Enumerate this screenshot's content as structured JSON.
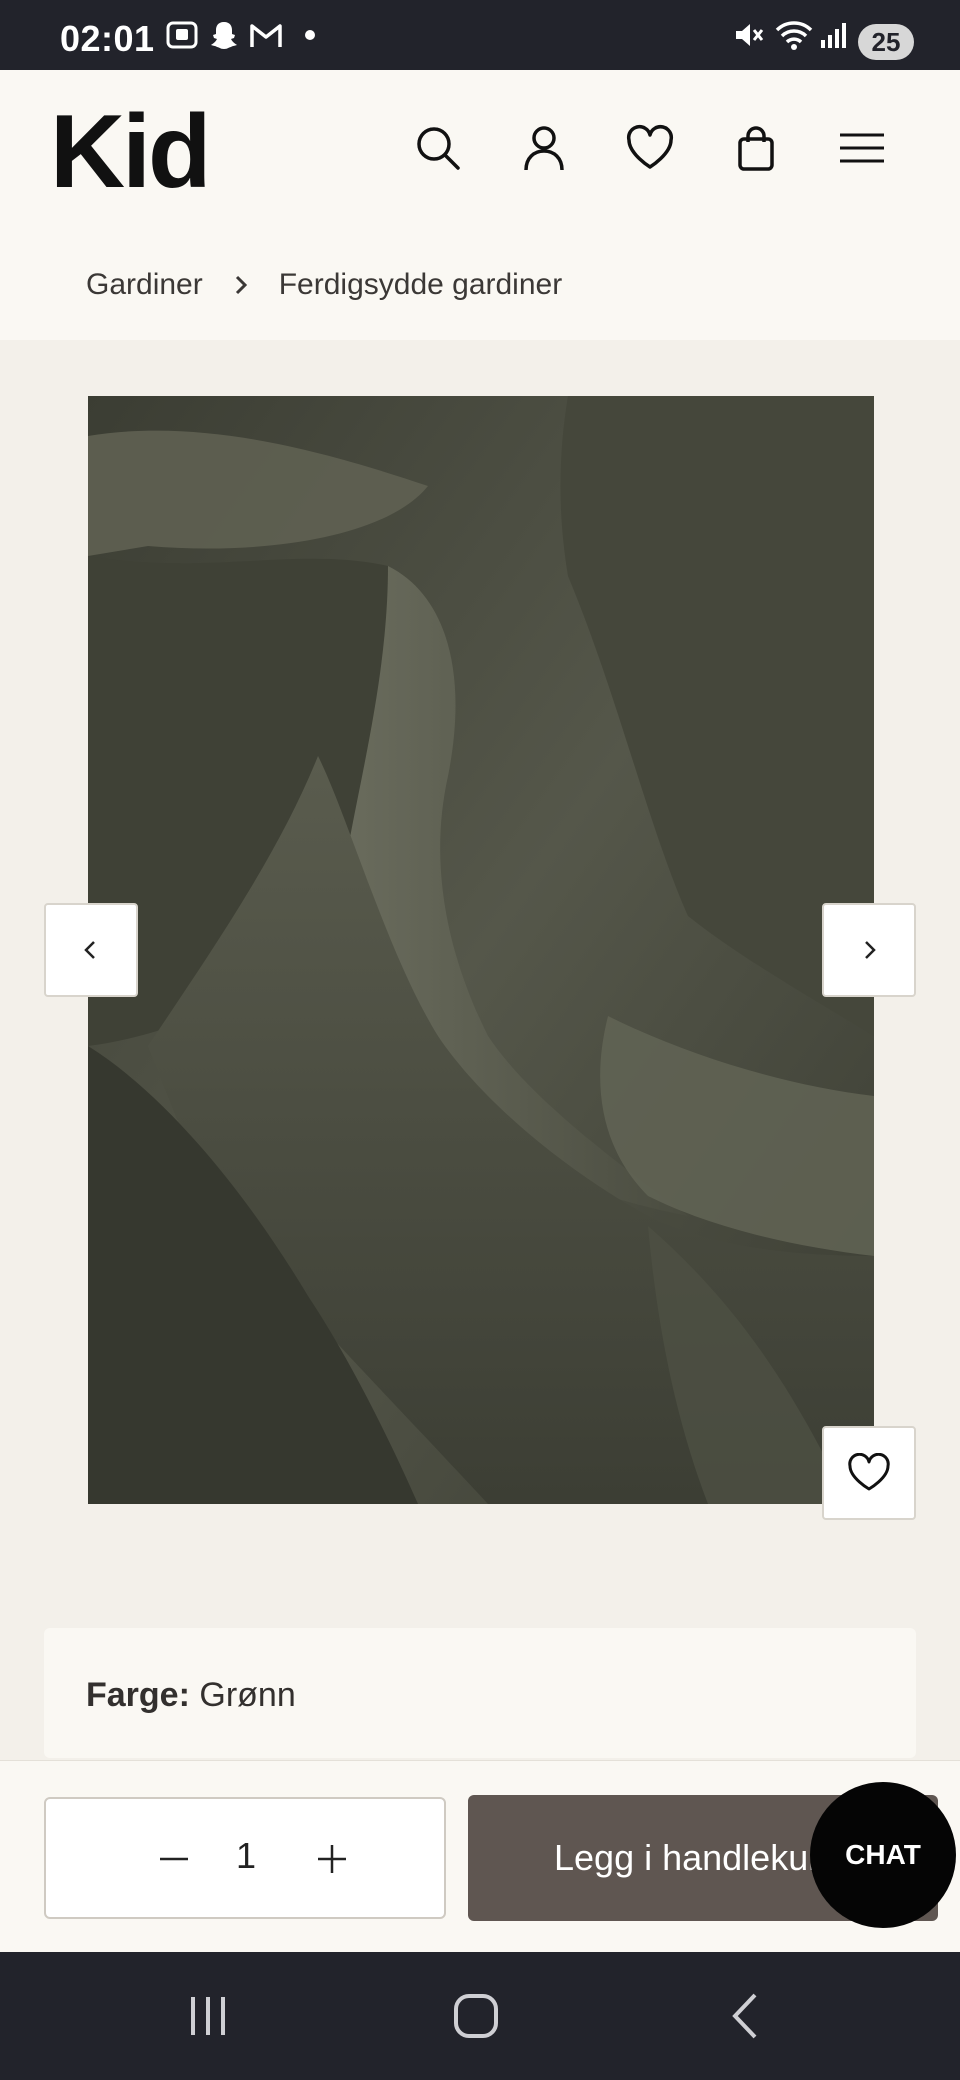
{
  "status_bar": {
    "time": "02:01",
    "battery": "25",
    "icons": [
      "screenshot-icon",
      "snapchat-icon",
      "gmail-icon",
      "dot-icon",
      "mute-icon",
      "wifi-icon",
      "signal-icon"
    ]
  },
  "header": {
    "logo": "Kid",
    "icons": [
      "search-icon",
      "account-icon",
      "wishlist-icon",
      "cart-icon",
      "menu-icon"
    ]
  },
  "breadcrumb": {
    "items": [
      "Gardiner",
      "Ferdigsydde gardiner"
    ]
  },
  "gallery": {
    "image": "green-velvet-fabric",
    "prev_icon": "chevron-left-icon",
    "next_icon": "chevron-right-icon",
    "favorite_icon": "heart-icon"
  },
  "product": {
    "color_label": "Farge:",
    "color_value": "Grønn"
  },
  "buy_bar": {
    "quantity": "1",
    "add_to_cart": "Legg i handlekurv",
    "chat": "CHAT"
  },
  "system_nav": {
    "icons": [
      "recents-icon",
      "home-icon",
      "back-icon"
    ]
  },
  "colors": {
    "status_bg": "#22232b",
    "header_bg": "#faf8f3",
    "page_bg": "#f3f0ea",
    "fabric": "#4d4f42",
    "add_button": "#5f5651",
    "chat_button": "#050505"
  }
}
